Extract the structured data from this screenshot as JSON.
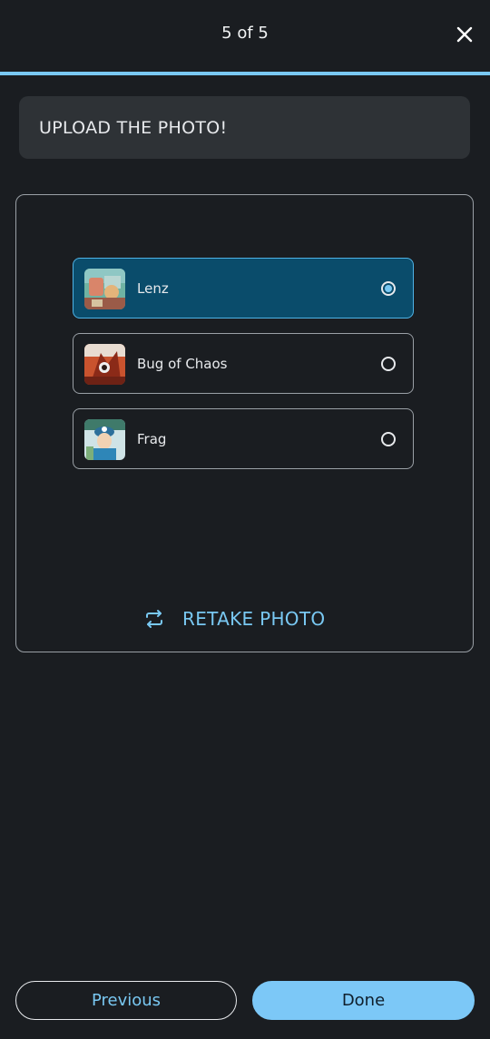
{
  "header": {
    "step_text": "5 of 5",
    "close_icon": "close-icon"
  },
  "progress": {
    "value": 1.0,
    "color": "#79c8f2"
  },
  "banner": {
    "title": "UPLOAD THE PHOTO!"
  },
  "options": [
    {
      "label": "Lenz",
      "selected": true,
      "icon": "avatar-thumbnail"
    },
    {
      "label": "Bug of Chaos",
      "selected": false,
      "icon": "avatar-thumbnail"
    },
    {
      "label": "Frag",
      "selected": false,
      "icon": "avatar-thumbnail"
    }
  ],
  "retake": {
    "label": "RETAKE PHOTO",
    "icon": "repeat-icon"
  },
  "footer": {
    "previous_label": "Previous",
    "done_label": "Done"
  },
  "colors": {
    "accent": "#79c8f2",
    "selected_bg": "#0a4c6b",
    "background": "#1a1d21"
  }
}
